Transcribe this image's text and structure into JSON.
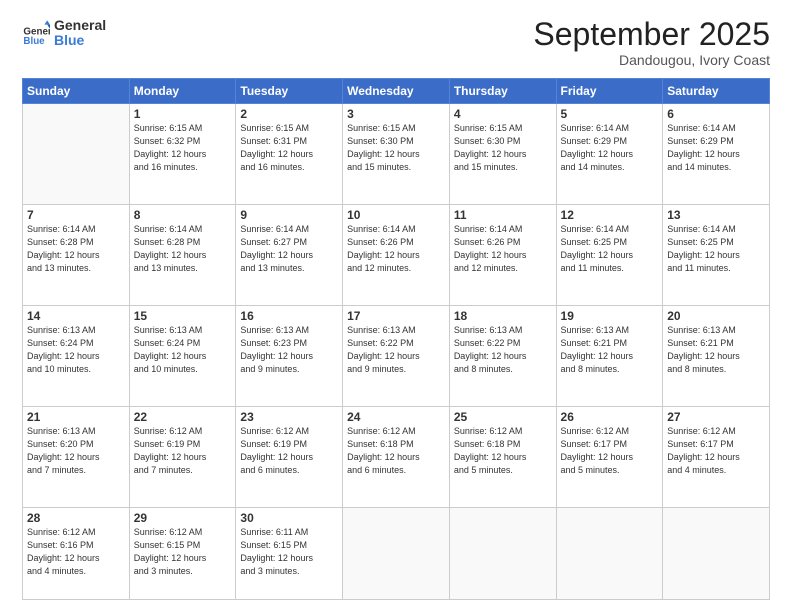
{
  "header": {
    "logo_general": "General",
    "logo_blue": "Blue",
    "month": "September 2025",
    "location": "Dandougou, Ivory Coast"
  },
  "days_of_week": [
    "Sunday",
    "Monday",
    "Tuesday",
    "Wednesday",
    "Thursday",
    "Friday",
    "Saturday"
  ],
  "weeks": [
    [
      {
        "num": "",
        "info": ""
      },
      {
        "num": "1",
        "info": "Sunrise: 6:15 AM\nSunset: 6:32 PM\nDaylight: 12 hours\nand 16 minutes."
      },
      {
        "num": "2",
        "info": "Sunrise: 6:15 AM\nSunset: 6:31 PM\nDaylight: 12 hours\nand 16 minutes."
      },
      {
        "num": "3",
        "info": "Sunrise: 6:15 AM\nSunset: 6:30 PM\nDaylight: 12 hours\nand 15 minutes."
      },
      {
        "num": "4",
        "info": "Sunrise: 6:15 AM\nSunset: 6:30 PM\nDaylight: 12 hours\nand 15 minutes."
      },
      {
        "num": "5",
        "info": "Sunrise: 6:14 AM\nSunset: 6:29 PM\nDaylight: 12 hours\nand 14 minutes."
      },
      {
        "num": "6",
        "info": "Sunrise: 6:14 AM\nSunset: 6:29 PM\nDaylight: 12 hours\nand 14 minutes."
      }
    ],
    [
      {
        "num": "7",
        "info": "Sunrise: 6:14 AM\nSunset: 6:28 PM\nDaylight: 12 hours\nand 13 minutes."
      },
      {
        "num": "8",
        "info": "Sunrise: 6:14 AM\nSunset: 6:28 PM\nDaylight: 12 hours\nand 13 minutes."
      },
      {
        "num": "9",
        "info": "Sunrise: 6:14 AM\nSunset: 6:27 PM\nDaylight: 12 hours\nand 13 minutes."
      },
      {
        "num": "10",
        "info": "Sunrise: 6:14 AM\nSunset: 6:26 PM\nDaylight: 12 hours\nand 12 minutes."
      },
      {
        "num": "11",
        "info": "Sunrise: 6:14 AM\nSunset: 6:26 PM\nDaylight: 12 hours\nand 12 minutes."
      },
      {
        "num": "12",
        "info": "Sunrise: 6:14 AM\nSunset: 6:25 PM\nDaylight: 12 hours\nand 11 minutes."
      },
      {
        "num": "13",
        "info": "Sunrise: 6:14 AM\nSunset: 6:25 PM\nDaylight: 12 hours\nand 11 minutes."
      }
    ],
    [
      {
        "num": "14",
        "info": "Sunrise: 6:13 AM\nSunset: 6:24 PM\nDaylight: 12 hours\nand 10 minutes."
      },
      {
        "num": "15",
        "info": "Sunrise: 6:13 AM\nSunset: 6:24 PM\nDaylight: 12 hours\nand 10 minutes."
      },
      {
        "num": "16",
        "info": "Sunrise: 6:13 AM\nSunset: 6:23 PM\nDaylight: 12 hours\nand 9 minutes."
      },
      {
        "num": "17",
        "info": "Sunrise: 6:13 AM\nSunset: 6:22 PM\nDaylight: 12 hours\nand 9 minutes."
      },
      {
        "num": "18",
        "info": "Sunrise: 6:13 AM\nSunset: 6:22 PM\nDaylight: 12 hours\nand 8 minutes."
      },
      {
        "num": "19",
        "info": "Sunrise: 6:13 AM\nSunset: 6:21 PM\nDaylight: 12 hours\nand 8 minutes."
      },
      {
        "num": "20",
        "info": "Sunrise: 6:13 AM\nSunset: 6:21 PM\nDaylight: 12 hours\nand 8 minutes."
      }
    ],
    [
      {
        "num": "21",
        "info": "Sunrise: 6:13 AM\nSunset: 6:20 PM\nDaylight: 12 hours\nand 7 minutes."
      },
      {
        "num": "22",
        "info": "Sunrise: 6:12 AM\nSunset: 6:19 PM\nDaylight: 12 hours\nand 7 minutes."
      },
      {
        "num": "23",
        "info": "Sunrise: 6:12 AM\nSunset: 6:19 PM\nDaylight: 12 hours\nand 6 minutes."
      },
      {
        "num": "24",
        "info": "Sunrise: 6:12 AM\nSunset: 6:18 PM\nDaylight: 12 hours\nand 6 minutes."
      },
      {
        "num": "25",
        "info": "Sunrise: 6:12 AM\nSunset: 6:18 PM\nDaylight: 12 hours\nand 5 minutes."
      },
      {
        "num": "26",
        "info": "Sunrise: 6:12 AM\nSunset: 6:17 PM\nDaylight: 12 hours\nand 5 minutes."
      },
      {
        "num": "27",
        "info": "Sunrise: 6:12 AM\nSunset: 6:17 PM\nDaylight: 12 hours\nand 4 minutes."
      }
    ],
    [
      {
        "num": "28",
        "info": "Sunrise: 6:12 AM\nSunset: 6:16 PM\nDaylight: 12 hours\nand 4 minutes."
      },
      {
        "num": "29",
        "info": "Sunrise: 6:12 AM\nSunset: 6:15 PM\nDaylight: 12 hours\nand 3 minutes."
      },
      {
        "num": "30",
        "info": "Sunrise: 6:11 AM\nSunset: 6:15 PM\nDaylight: 12 hours\nand 3 minutes."
      },
      {
        "num": "",
        "info": ""
      },
      {
        "num": "",
        "info": ""
      },
      {
        "num": "",
        "info": ""
      },
      {
        "num": "",
        "info": ""
      }
    ]
  ]
}
